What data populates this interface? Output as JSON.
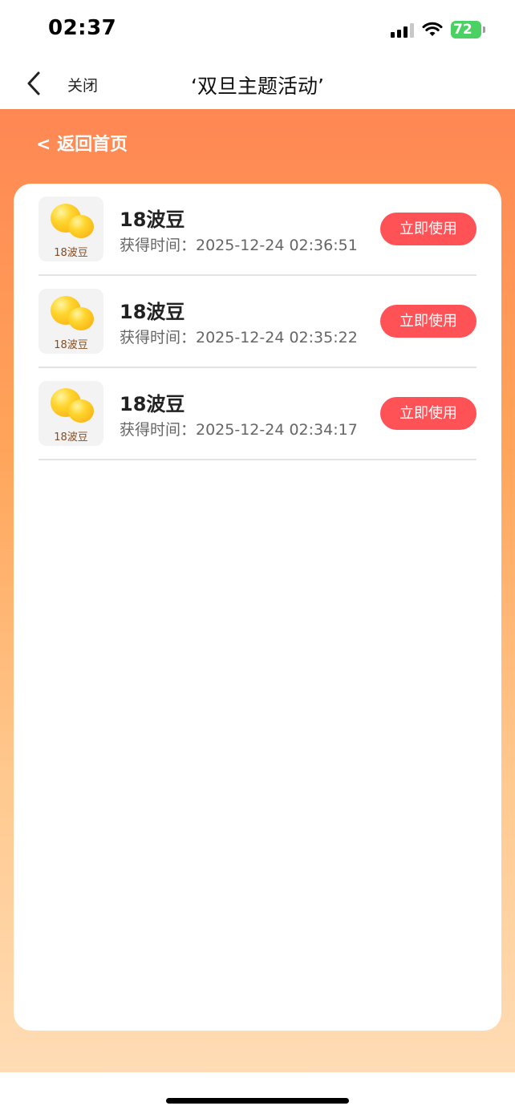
{
  "status_bar": {
    "time": "02:37",
    "battery": "72",
    "icons": [
      "signal-icon",
      "wifi-icon",
      "battery-charging-icon"
    ]
  },
  "nav": {
    "close_label": "关闭",
    "title": "‘双旦主题活动’",
    "back_icon": "chevron-left-icon"
  },
  "page": {
    "back_home_label": "< 返回首页",
    "colors": {
      "gradient_top": "#ff8753",
      "gradient_bottom": "#ffdcb5",
      "button": "#ff5257"
    }
  },
  "rewards": [
    {
      "thumb_label": "18波豆",
      "title": "18波豆",
      "time": "获得时间：2025-12-24 02:36:51",
      "button_label": "立即使用"
    },
    {
      "thumb_label": "18波豆",
      "title": "18波豆",
      "time": "获得时间：2025-12-24 02:35:22",
      "button_label": "立即使用"
    },
    {
      "thumb_label": "18波豆",
      "title": "18波豆",
      "time": "获得时间：2025-12-24 02:34:17",
      "button_label": "立即使用"
    }
  ]
}
